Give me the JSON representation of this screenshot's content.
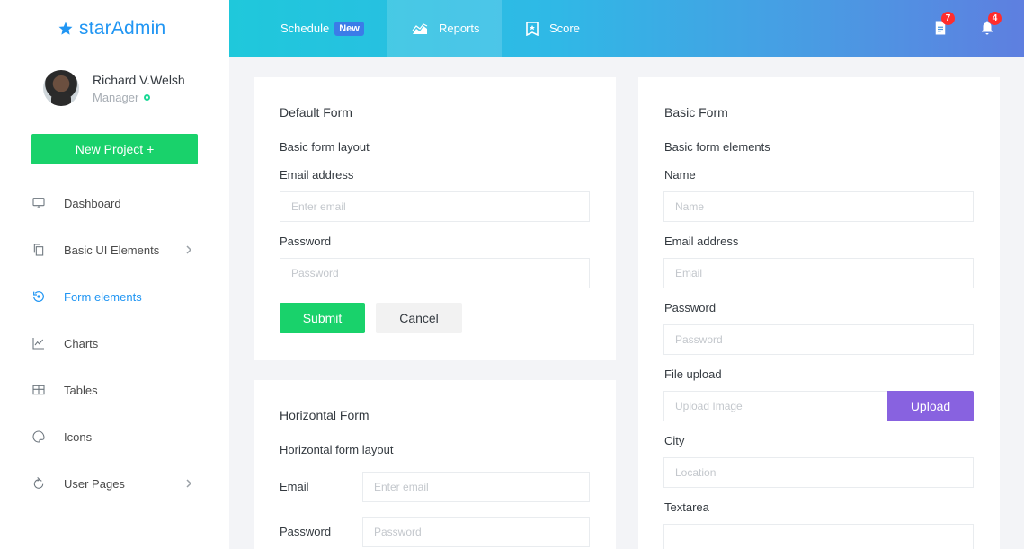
{
  "brand": {
    "prefix": "star",
    "suffix": "Admin"
  },
  "profile": {
    "name": "Richard V.Welsh",
    "role": "Manager"
  },
  "sidebar": {
    "new_project_label": "New Project +",
    "items": [
      {
        "label": "Dashboard",
        "icon": "monitor-icon"
      },
      {
        "label": "Basic UI Elements",
        "icon": "copy-icon"
      },
      {
        "label": "Form elements",
        "icon": "restore-icon",
        "active": true
      },
      {
        "label": "Charts",
        "icon": "chart-line-icon"
      },
      {
        "label": "Tables",
        "icon": "table-icon"
      },
      {
        "label": "Icons",
        "icon": "palette-icon"
      },
      {
        "label": "User Pages",
        "icon": "refresh-icon"
      }
    ]
  },
  "header": {
    "tabs": [
      {
        "label": "Schedule",
        "badge": "New"
      },
      {
        "label": "Reports"
      },
      {
        "label": "Score"
      }
    ],
    "doc_count": "7",
    "bell_count": "4"
  },
  "default_form": {
    "title": "Default Form",
    "description": "Basic form layout",
    "email_label": "Email address",
    "email_placeholder": "Enter email",
    "password_label": "Password",
    "password_placeholder": "Password",
    "submit_label": "Submit",
    "cancel_label": "Cancel"
  },
  "horizontal_form": {
    "title": "Horizontal Form",
    "description": "Horizontal form layout",
    "email_label": "Email",
    "email_placeholder": "Enter email",
    "password_label": "Password",
    "password_placeholder": "Password"
  },
  "basic_form": {
    "title": "Basic Form",
    "description": "Basic form elements",
    "name_label": "Name",
    "name_placeholder": "Name",
    "email_label": "Email address",
    "email_placeholder": "Email",
    "password_label": "Password",
    "password_placeholder": "Password",
    "file_label": "File upload",
    "file_placeholder": "Upload Image",
    "upload_label": "Upload",
    "city_label": "City",
    "city_placeholder": "Location",
    "textarea_label": "Textarea"
  },
  "colors": {
    "accent": "#2196f3",
    "success": "#19d26b",
    "upload": "#8862e0",
    "badge": "#ff2d2d"
  }
}
